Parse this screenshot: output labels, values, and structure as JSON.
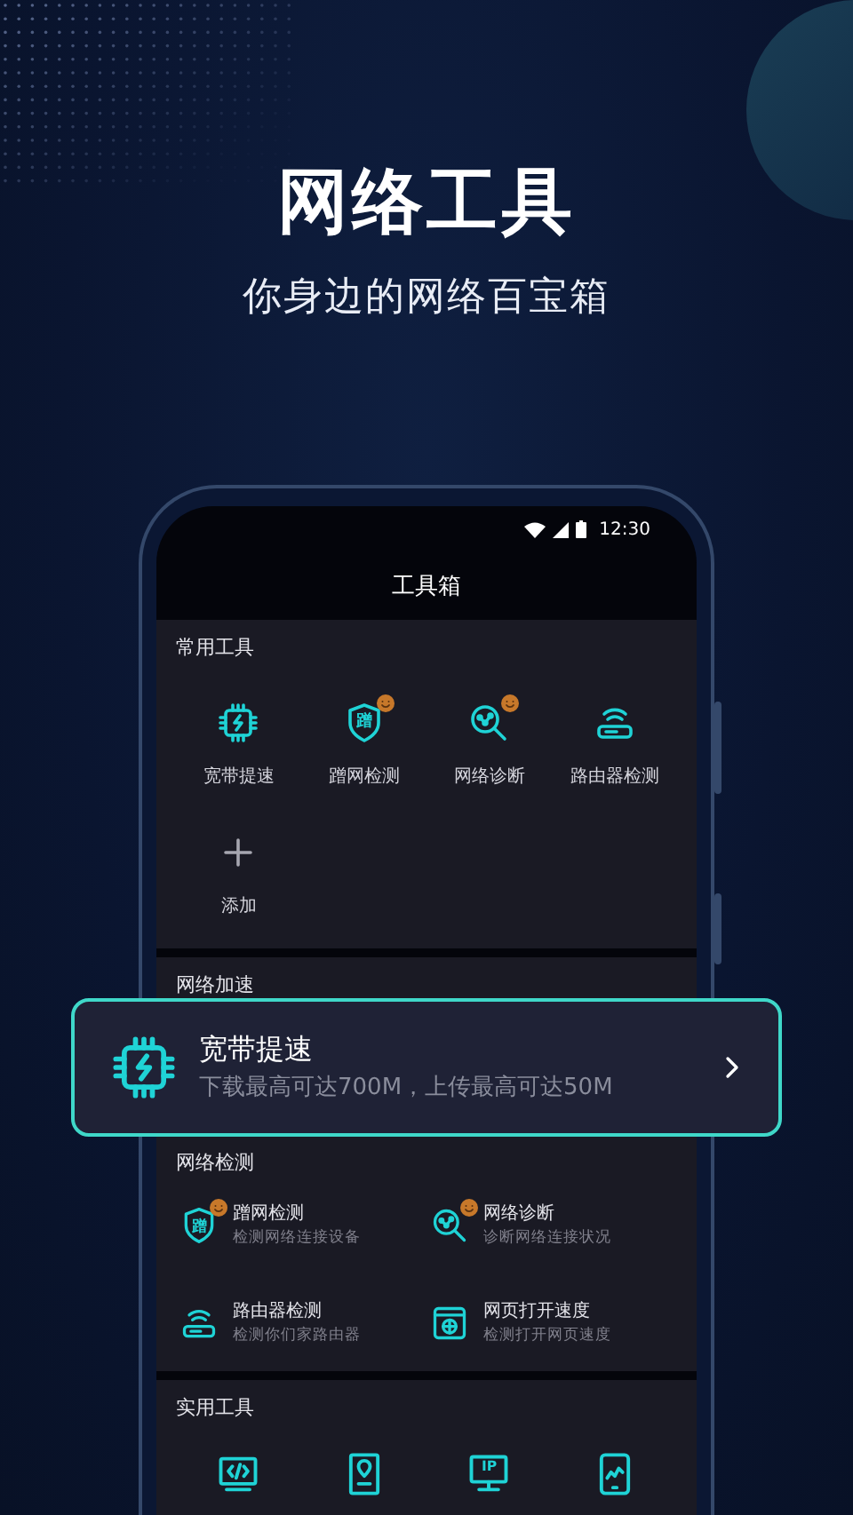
{
  "hero": {
    "title": "网络工具",
    "subtitle": "你身边的网络百宝箱"
  },
  "status_bar": {
    "time": "12:30"
  },
  "screen_title": "工具箱",
  "common_tools": {
    "title": "常用工具",
    "items": [
      {
        "kind": "boost",
        "label": "宽带提速",
        "badge": false
      },
      {
        "kind": "shield",
        "glyph": "蹭",
        "label": "蹭网检测",
        "badge": true
      },
      {
        "kind": "diagnose",
        "label": "网络诊断",
        "badge": true
      },
      {
        "kind": "router",
        "label": "路由器检测",
        "badge": false
      },
      {
        "kind": "add",
        "label": "添加",
        "badge": false
      }
    ]
  },
  "acceleration": {
    "title": "网络加速",
    "card": {
      "kind": "boost",
      "title": "宽带提速",
      "description": "下载最高可达700M，上传最高可达50M"
    }
  },
  "detection": {
    "title": "网络检测",
    "items": [
      {
        "kind": "shield",
        "glyph": "蹭",
        "title": "蹭网检测",
        "description": "检测网络连接设备",
        "badge": true
      },
      {
        "kind": "diagnose",
        "title": "网络诊断",
        "description": "诊断网络连接状况",
        "badge": true
      },
      {
        "kind": "router",
        "title": "路由器检测",
        "description": "检测你们家路由器",
        "badge": false
      },
      {
        "kind": "webpage",
        "title": "网页打开速度",
        "description": "检测打开网页速度",
        "badge": false
      }
    ]
  },
  "utilities": {
    "title": "实用工具",
    "items": [
      {
        "kind": "code"
      },
      {
        "kind": "location"
      },
      {
        "kind": "ip",
        "glyph": "IP"
      },
      {
        "kind": "chart"
      }
    ]
  }
}
